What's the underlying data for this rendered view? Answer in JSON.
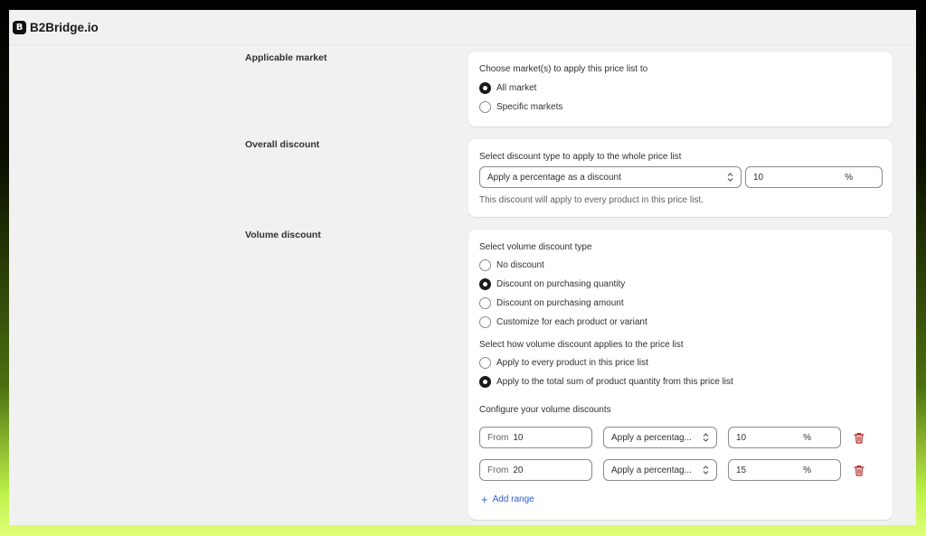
{
  "app": {
    "name": "B2Bridge.io"
  },
  "sections": {
    "market": {
      "label": "Applicable market",
      "prompt": "Choose market(s) to apply this price list to",
      "options": [
        {
          "label": "All market",
          "selected": true
        },
        {
          "label": "Specific markets",
          "selected": false
        }
      ]
    },
    "overall": {
      "label": "Overall discount",
      "prompt": "Select discount type to apply to the whole price list",
      "type_value": "Apply a percentage as a discount",
      "amount_value": "10",
      "amount_suffix": "%",
      "help": "This discount will apply to every product in this price list."
    },
    "volume": {
      "label": "Volume discount",
      "type_prompt": "Select volume discount type",
      "type_options": [
        {
          "label": "No discount",
          "selected": false
        },
        {
          "label": "Discount on purchasing quantity",
          "selected": true
        },
        {
          "label": "Discount on purchasing amount",
          "selected": false
        },
        {
          "label": "Customize for each product or variant",
          "selected": false
        }
      ],
      "apply_prompt": "Select how volume discount applies to the price list",
      "apply_options": [
        {
          "label": "Apply to every product in this price list",
          "selected": false
        },
        {
          "label": "Apply to the total sum of product quantity from this price list",
          "selected": true
        }
      ],
      "configure_label": "Configure your volume discounts",
      "ranges": [
        {
          "from_prefix": "From",
          "from_value": "10",
          "type_value": "Apply a percentag...",
          "amount_value": "10",
          "amount_suffix": "%"
        },
        {
          "from_prefix": "From",
          "from_value": "20",
          "type_value": "Apply a percentag...",
          "amount_value": "15",
          "amount_suffix": "%"
        }
      ],
      "add_range_label": "Add range"
    }
  },
  "colors": {
    "accent_link": "#2c5ed0",
    "delete_icon": "#b3261e"
  }
}
